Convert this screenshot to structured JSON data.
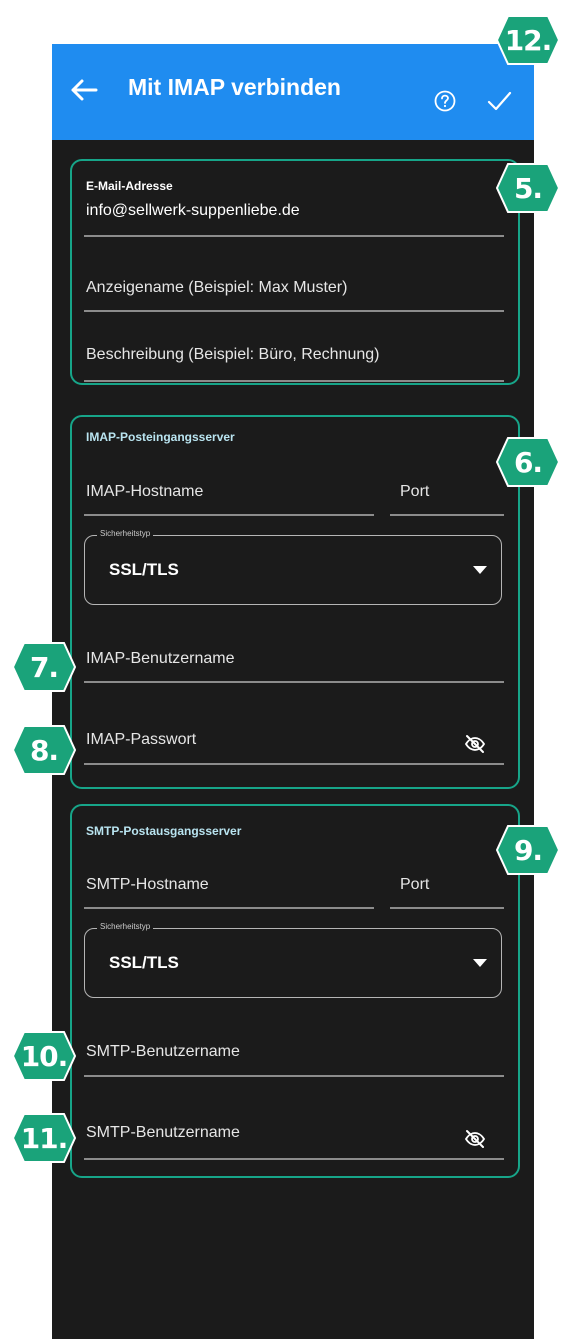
{
  "appbar": {
    "title": "Mit IMAP verbinden",
    "back_icon": "arrow-left-icon",
    "help_icon": "help-circle-icon",
    "confirm_icon": "check-icon",
    "color": "#1f8cf0"
  },
  "account": {
    "email_label": "E-Mail-Adresse",
    "email_value": "info@sellwerk-suppenliebe.de",
    "display_name_placeholder": "Anzeigename (Beispiel: Max Muster)",
    "description_placeholder": "Beschreibung (Beispiel: Büro, Rechnung)"
  },
  "imap": {
    "header": "IMAP-Posteingangsserver",
    "hostname_placeholder": "IMAP-Hostname",
    "port_placeholder": "Port",
    "security_label": "Sicherheitstyp",
    "security_value": "SSL/TLS",
    "username_placeholder": "IMAP-Benutzername",
    "password_placeholder": "IMAP-Passwort"
  },
  "smtp": {
    "header": "SMTP-Postausgangsserver",
    "hostname_placeholder": "SMTP-Hostname",
    "port_placeholder": "Port",
    "security_label": "Sicherheitstyp",
    "security_value": "SSL/TLS",
    "username_placeholder": "SMTP-Benutzername",
    "password_placeholder": "SMTP-Benutzername"
  },
  "badges": {
    "b5": "5.",
    "b6": "6.",
    "b7": "7.",
    "b8": "8.",
    "b9": "9.",
    "b10": "10.",
    "b11": "11.",
    "b12": "12."
  },
  "colors": {
    "badge": "#1aa37a",
    "section_border": "#17a589",
    "background": "#1b1b1b"
  }
}
